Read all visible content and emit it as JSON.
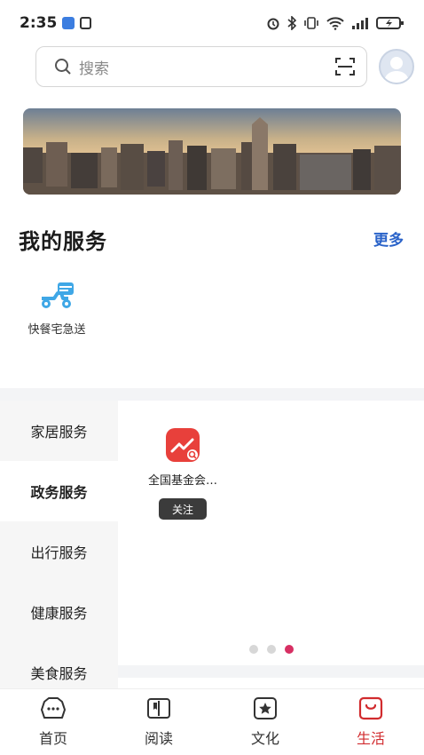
{
  "status_bar": {
    "time": "2:35",
    "icons": [
      "app-badge-icon",
      "nfc-icon",
      "alarm-icon",
      "bluetooth-icon",
      "vibrate-icon",
      "wifi-icon",
      "signal-icon",
      "battery-icon"
    ]
  },
  "search": {
    "placeholder": "搜索",
    "icons": [
      "search-icon",
      "scan-icon"
    ]
  },
  "my_services": {
    "title": "我的服务",
    "more": "更多",
    "items": [
      {
        "label": "快餐宅急送",
        "icon": "delivery-scooter-icon",
        "color": "#3fa7e6"
      }
    ]
  },
  "categories": [
    {
      "label": "家居服务"
    },
    {
      "label": "政务服务"
    },
    {
      "label": "出行服务"
    },
    {
      "label": "健康服务"
    },
    {
      "label": "美食服务"
    }
  ],
  "active_category": "政务服务",
  "category_cards": [
    {
      "name": "全国基金会…",
      "button": "关注",
      "icon": "trend-chart-icon",
      "color": "#e8403b"
    }
  ],
  "pagination": {
    "total": 3,
    "active_index": 2,
    "active_color": "#d72f63"
  },
  "tabs": [
    {
      "label": "首页",
      "icon": "home-icon"
    },
    {
      "label": "阅读",
      "icon": "book-icon"
    },
    {
      "label": "文化",
      "icon": "star-frame-icon"
    },
    {
      "label": "生活",
      "icon": "life-bag-icon"
    }
  ],
  "active_tab": "生活",
  "accent_color": "#d12b2e"
}
